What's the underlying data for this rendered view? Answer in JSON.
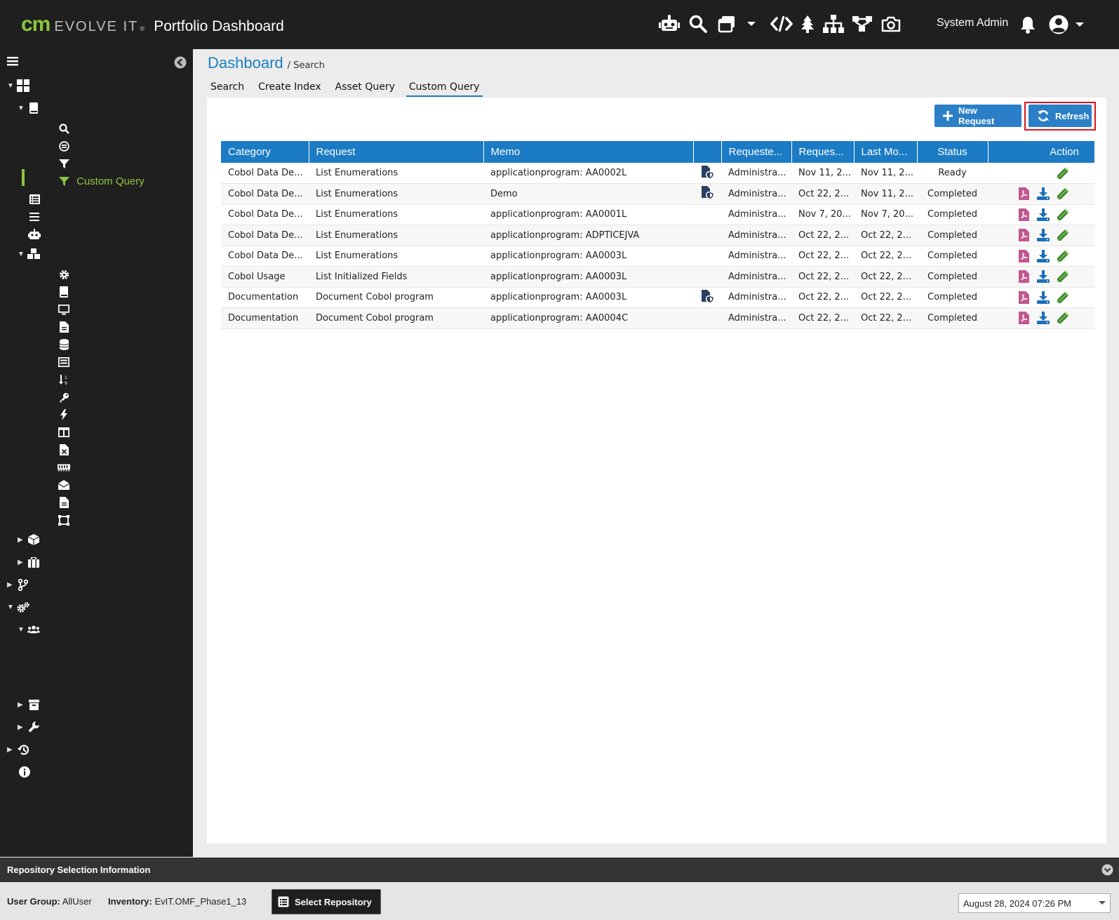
{
  "header": {
    "logo_cm": "cm",
    "logo_evolve": "EVOLVE IT",
    "logo_reg": "®",
    "title": "Portfolio Dashboard",
    "user": "System Admin",
    "icons": [
      "robot-icon",
      "search-icon",
      "windows-icon",
      "dropdown-icon",
      "code-icon",
      "tree-icon",
      "sitemap-icon",
      "flow-icon",
      "camera-icon"
    ]
  },
  "sidebar": {
    "items": [
      {
        "label": "Dashboard",
        "icon": "dashboard-icon"
      },
      {
        "label": "Text Search",
        "icon": "book-icon"
      },
      {
        "label": "Search",
        "icon": "search-icon"
      },
      {
        "label": "Create Index",
        "icon": "index-icon"
      },
      {
        "label": "Asset Query",
        "icon": "filter-icon"
      },
      {
        "label": "Custom Query",
        "icon": "filter-icon"
      },
      {
        "label": "Statistics",
        "icon": "list-icon"
      },
      {
        "label": "Menu",
        "icon": "menu-icon"
      },
      {
        "label": "AI Analysis",
        "icon": "robot-icon"
      },
      {
        "label": "Asset Browser",
        "icon": "cubes-icon"
      },
      {
        "label": "Application Program",
        "icon": "gear-icon"
      },
      {
        "label": "Copybook",
        "icon": "book-icon"
      },
      {
        "label": "Screen",
        "icon": "monitor-icon"
      },
      {
        "label": "Report",
        "icon": "file-icon"
      },
      {
        "label": "Table",
        "icon": "database-icon"
      },
      {
        "label": "View",
        "icon": "view-icon"
      },
      {
        "label": "Index",
        "icon": "sort-icon"
      },
      {
        "label": "Constraint",
        "icon": "key-icon"
      },
      {
        "label": "Trigger",
        "icon": "bolt-icon"
      },
      {
        "label": "Column",
        "icon": "columns-icon"
      },
      {
        "label": "Ext File",
        "icon": "file-excel-icon"
      },
      {
        "label": "Shared Memory",
        "icon": "memory-icon"
      },
      {
        "label": "MQ",
        "icon": "envelope-icon"
      },
      {
        "label": "Other Asset",
        "icon": "file-icon"
      },
      {
        "label": "Business Term",
        "icon": "term-icon"
      },
      {
        "label": "Object Management",
        "icon": "cube-icon"
      },
      {
        "label": "Business Term",
        "icon": "briefcase-icon"
      },
      {
        "label": "Data Lineage",
        "icon": "branch-icon"
      },
      {
        "label": "Administrator",
        "icon": "gears-icon"
      },
      {
        "label": "User Management",
        "icon": "users-icon"
      },
      {
        "label": "User",
        "icon": ""
      },
      {
        "label": "Role",
        "icon": ""
      },
      {
        "label": "User Group",
        "icon": ""
      },
      {
        "label": "Inventory Management",
        "icon": "archive-icon"
      },
      {
        "label": "Settings",
        "icon": "wrench-icon"
      },
      {
        "label": "Usage",
        "icon": "history-icon"
      },
      {
        "label": "About",
        "icon": "info-icon"
      }
    ]
  },
  "breadcrumb": {
    "main": "Dashboard",
    "sub": "/ Search"
  },
  "tabs": [
    "Search",
    "Create Index",
    "Asset Query",
    "Custom Query"
  ],
  "buttons": {
    "new_request": "New Request",
    "refresh": "Refresh"
  },
  "table": {
    "columns": [
      "Category",
      "Request",
      "Memo",
      "",
      "Requeste...",
      "Reques...",
      "Last Mo...",
      "Status",
      "Action"
    ],
    "rows": [
      {
        "category": "Cobol Data De...",
        "request": "List Enumerations",
        "memo": "applicationprogram: AA0002L",
        "shield": true,
        "requester": "Administra...",
        "requested": "Nov 11, 2...",
        "last_modified": "Nov 11, 2...",
        "status": "Ready",
        "actions": [
          "edit"
        ]
      },
      {
        "category": "Cobol Data De...",
        "request": "List Enumerations",
        "memo": "Demo",
        "shield": true,
        "requester": "Administra...",
        "requested": "Oct 22, 2...",
        "last_modified": "Nov 11, 2...",
        "status": "Completed",
        "actions": [
          "pdf",
          "download",
          "edit"
        ]
      },
      {
        "category": "Cobol Data De...",
        "request": "List Enumerations",
        "memo": "applicationprogram: AA0001L",
        "shield": false,
        "requester": "Administra...",
        "requested": "Nov 7, 20...",
        "last_modified": "Nov 7, 20...",
        "status": "Completed",
        "actions": [
          "pdf",
          "download",
          "edit"
        ]
      },
      {
        "category": "Cobol Data De...",
        "request": "List Enumerations",
        "memo": "applicationprogram: ADPTICEJVA",
        "shield": false,
        "requester": "Administra...",
        "requested": "Oct 22, 2...",
        "last_modified": "Oct 22, 2...",
        "status": "Completed",
        "actions": [
          "pdf",
          "download",
          "edit"
        ]
      },
      {
        "category": "Cobol Data De...",
        "request": "List Enumerations",
        "memo": "applicationprogram: AA0003L",
        "shield": false,
        "requester": "Administra...",
        "requested": "Oct 22, 2...",
        "last_modified": "Oct 22, 2...",
        "status": "Completed",
        "actions": [
          "pdf",
          "download",
          "edit"
        ]
      },
      {
        "category": "Cobol Usage",
        "request": "List Initialized Fields",
        "memo": "applicationprogram: AA0003L",
        "shield": false,
        "requester": "Administra...",
        "requested": "Oct 22, 2...",
        "last_modified": "Oct 22, 2...",
        "status": "Completed",
        "actions": [
          "pdf",
          "download",
          "edit"
        ]
      },
      {
        "category": "Documentation",
        "request": "Document Cobol program",
        "memo": "applicationprogram: AA0003L",
        "shield": true,
        "requester": "Administra...",
        "requested": "Oct 22, 2...",
        "last_modified": "Oct 22, 2...",
        "status": "Completed",
        "actions": [
          "pdf",
          "download",
          "edit"
        ]
      },
      {
        "category": "Documentation",
        "request": "Document Cobol program",
        "memo": "applicationprogram: AA0004C",
        "shield": false,
        "requester": "Administra...",
        "requested": "Oct 22, 2...",
        "last_modified": "Oct 22, 2...",
        "status": "Completed",
        "actions": [
          "pdf",
          "download",
          "edit"
        ]
      }
    ]
  },
  "footer": {
    "title": "Repository Selection Information",
    "user_group_label": "User Group:",
    "user_group_value": "AllUser",
    "inventory_label": "Inventory:",
    "inventory_value": "EvIT.OMF_Phase1_13",
    "select_repository": "Select Repository",
    "datetime": "August 28, 2024 07:26 PM"
  },
  "colors": {
    "accent": "#1b7bc4",
    "brand_green": "#8cc63f",
    "highlight": "#e0121a",
    "pdf": "#c0578e",
    "edit": "#3f8a2e"
  }
}
